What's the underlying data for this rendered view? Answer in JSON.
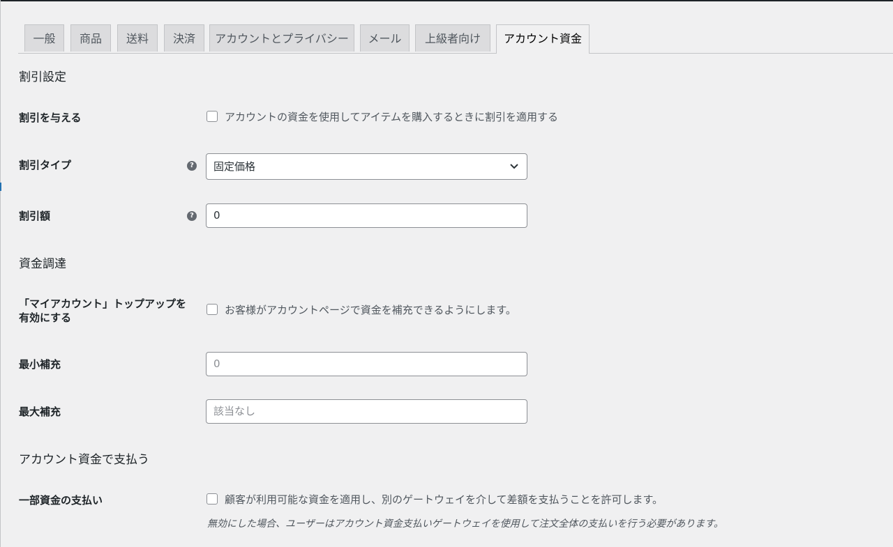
{
  "tabs": [
    {
      "label": "一般"
    },
    {
      "label": "商品"
    },
    {
      "label": "送料"
    },
    {
      "label": "決済"
    },
    {
      "label": "アカウントとプライバシー"
    },
    {
      "label": "メール"
    },
    {
      "label": "上級者向け"
    },
    {
      "label": "アカウント資金",
      "active": true
    }
  ],
  "discount": {
    "section_title": "割引設定",
    "give_discount": {
      "label": "割引を与える",
      "checkbox_text": "アカウントの資金を使用してアイテムを購入するときに割引を適用する",
      "checked": false
    },
    "type": {
      "label": "割引タイプ",
      "value": "固定価格"
    },
    "amount": {
      "label": "割引額",
      "value": "0"
    }
  },
  "funding": {
    "section_title": "資金調達",
    "topup": {
      "label_line1": "「マイアカウント」トップアップを",
      "label_line2": "有効にする",
      "checkbox_text": "お客様がアカウントページで資金を補充できるようにします。",
      "checked": false
    },
    "min_topup": {
      "label": "最小補充",
      "placeholder": "0"
    },
    "max_topup": {
      "label": "最大補充",
      "placeholder": "該当なし"
    }
  },
  "pay": {
    "section_title": "アカウント資金で支払う",
    "partial": {
      "label": "一部資金の支払い",
      "checkbox_text": "顧客が利用可能な資金を適用し、別のゲートウェイを介して差額を支払うことを許可します。",
      "checked": false,
      "note": "無効にした場合、ユーザーはアカウント資金支払いゲートウェイを使用して注文全体の支払いを行う必要があります。"
    }
  },
  "help_icon_glyph": "?"
}
